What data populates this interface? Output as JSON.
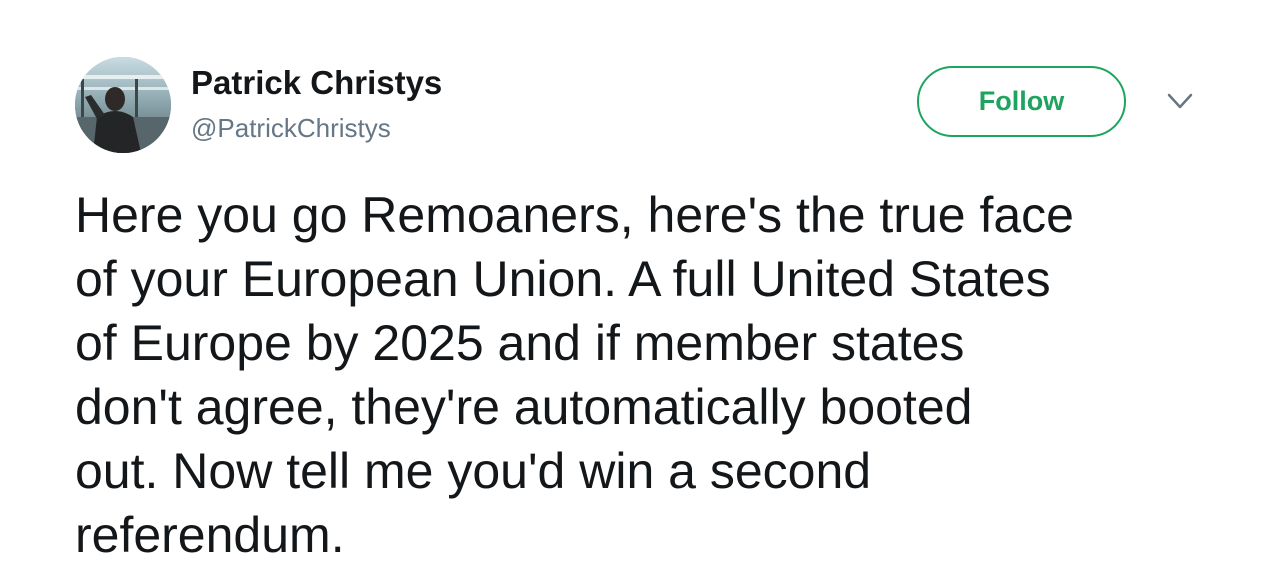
{
  "author": {
    "display_name": "Patrick Christys",
    "handle": "@PatrickChristys",
    "avatar_icon": "profile-photo"
  },
  "actions": {
    "follow_label": "Follow",
    "more_icon": "chevron-down-icon"
  },
  "tweet": {
    "text": "Here you go Remoaners, here's the true face\nof your European Union. A full United States\nof Europe by 2025 and if member states\ndon't agree, they're automatically booted\nout. Now tell me you'd win a second\nreferendum."
  },
  "colors": {
    "accent": "#1ea45e",
    "text": "#14171a",
    "secondary_text": "#657786",
    "chevron": "#657786"
  }
}
